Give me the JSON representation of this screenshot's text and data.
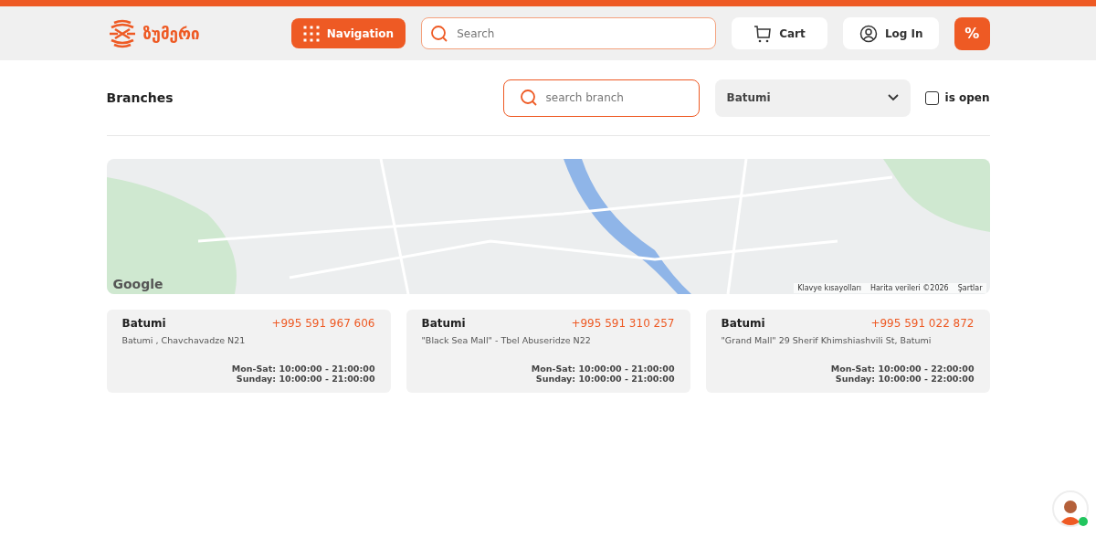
{
  "header": {
    "logo_text": "ზუმერი",
    "navigation_button": "Navigation",
    "search": {
      "placeholder": "Search"
    },
    "cart_button": "Cart",
    "login_button": "Log In",
    "discount_button": "%"
  },
  "branches": {
    "title": "Branches",
    "search": {
      "placeholder": "search branch"
    },
    "city_select": "Batumi",
    "is_open": {
      "label": "is open",
      "checked": false
    }
  },
  "map": {
    "logo": "Google",
    "attribution": [
      "Klavye kısayolları",
      "Harita verileri ©2026",
      "Şartlar"
    ]
  },
  "cards": [
    {
      "city": "Batumi",
      "phone": "+995 591 967 606",
      "address": "Batumi , Chavchavadze N21",
      "hours": [
        "Mon-Sat: 10:00:00 - 21:00:00",
        "Sunday: 10:00:00 - 21:00:00"
      ]
    },
    {
      "city": "Batumi",
      "phone": "+995 591 310 257",
      "address": "\"Black Sea Mall\" - Tbel Abuseridze N22",
      "hours": [
        "Mon-Sat: 10:00:00 - 21:00:00",
        "Sunday: 10:00:00 - 21:00:00"
      ]
    },
    {
      "city": "Batumi",
      "phone": "+995 591 022 872",
      "address": "\"Grand Mall\" 29 Sherif Khimshiashvili St, Batumi",
      "hours": [
        "Mon-Sat: 10:00:00 - 22:00:00",
        "Sunday: 10:00:00 - 22:00:00"
      ]
    }
  ],
  "chat": {
    "online": true
  }
}
